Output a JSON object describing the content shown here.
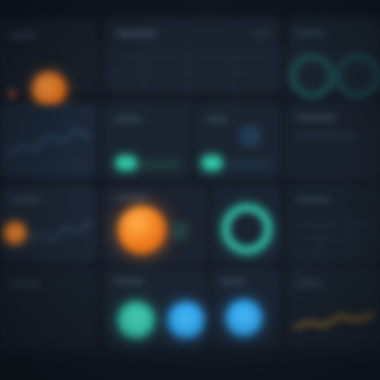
{
  "dashboard": {
    "accent_colors": {
      "orange": "#ff8a2a",
      "teal": "#2fc6a5",
      "blue": "#2ea8ff",
      "cyan": "#1fb7c9"
    },
    "widgets": [
      {
        "id": "widget-1",
        "indicator": "orange-dot"
      },
      {
        "id": "widget-2",
        "indicator": "grid"
      },
      {
        "id": "widget-3",
        "indicator": "teal-ring"
      },
      {
        "id": "widget-4",
        "indicator": "line-chart"
      },
      {
        "id": "widget-5",
        "indicator": "teal-progress"
      },
      {
        "id": "widget-6",
        "indicator": "line-chart"
      },
      {
        "id": "widget-7",
        "indicator": "orange-dot"
      },
      {
        "id": "widget-8",
        "indicator": "orange-sphere"
      },
      {
        "id": "widget-9",
        "indicator": "teal-donut"
      },
      {
        "id": "widget-10",
        "indicator": "line-chart"
      },
      {
        "id": "widget-11",
        "indicator": "teal-dot"
      },
      {
        "id": "widget-12",
        "indicator": "blue-dot"
      },
      {
        "id": "widget-13",
        "indicator": "blue-dot"
      },
      {
        "id": "widget-14",
        "indicator": "orange-line"
      }
    ]
  }
}
